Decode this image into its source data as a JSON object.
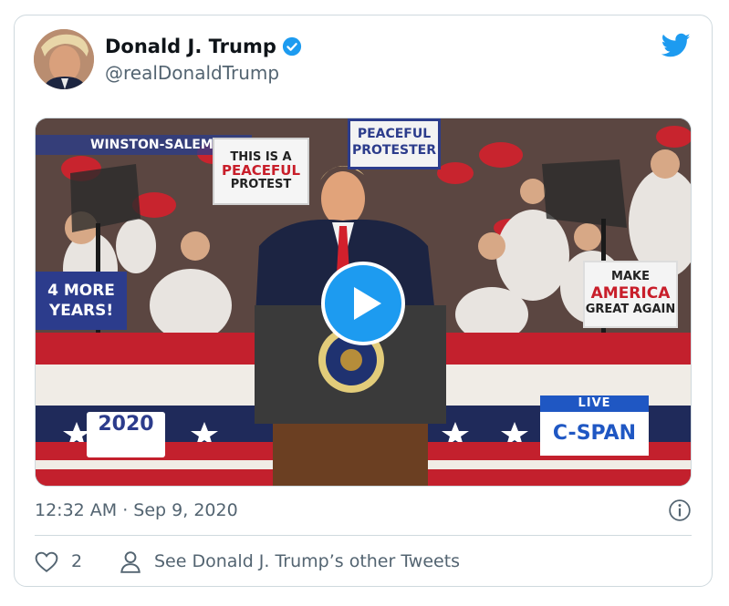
{
  "tweet": {
    "author_name": "Donald J. Trump",
    "author_handle": "@realDonaldTrump",
    "timestamp": "12:32 AM · Sep 9, 2020",
    "like_count": "2",
    "other_tweets_label": "See Donald J. Trump’s other Tweets"
  },
  "video": {
    "location": "WINSTON-SALEM, NC",
    "sign_protest_line1": "THIS IS A",
    "sign_protest_line2": "PEACEFUL",
    "sign_protest_line3": "PROTEST",
    "sign_peaceful_line1": "PEACEFUL",
    "sign_peaceful_line2": "PROTESTER",
    "sign_fourmore": "4 MORE YEARS!",
    "sign_maga_line1": "MAKE",
    "sign_maga_line2": "AMERICA",
    "sign_maga_line3": "GREAT AGAIN",
    "logo_2020": "2020",
    "live_label": "LIVE",
    "network": "C-SPAN"
  },
  "colors": {
    "twitter_blue": "#1d9bf0",
    "secondary_text": "#536471",
    "border": "#cfd9de"
  }
}
